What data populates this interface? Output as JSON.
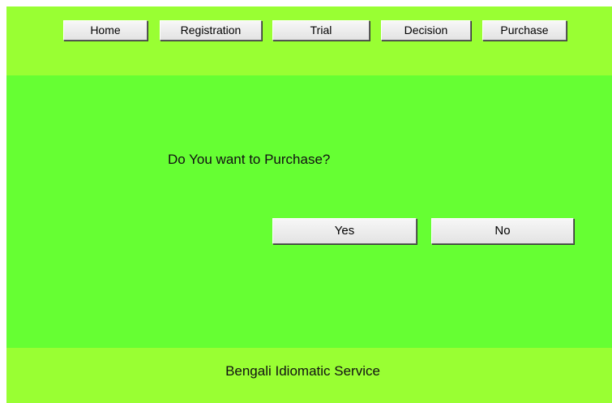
{
  "nav": {
    "items": [
      {
        "label": "Home"
      },
      {
        "label": "Registration"
      },
      {
        "label": "Trial"
      },
      {
        "label": "Decision"
      },
      {
        "label": "Purchase"
      }
    ]
  },
  "main": {
    "question": "Do You want to Purchase?",
    "yes_label": "Yes",
    "no_label": "No"
  },
  "footer": {
    "text": "Bengali Idiomatic Service"
  },
  "colors": {
    "header_bg": "#99ff33",
    "main_bg": "#66ff33",
    "footer_bg": "#99ff33"
  }
}
